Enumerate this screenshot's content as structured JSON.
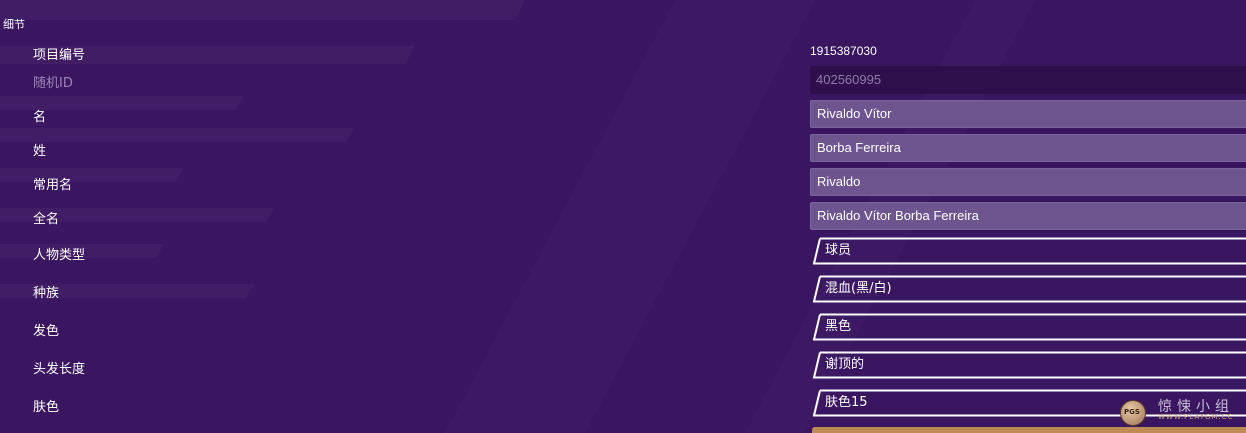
{
  "section": {
    "title": "细节"
  },
  "rows": {
    "project_id": {
      "label": "项目编号",
      "value": "1915387030"
    },
    "random_id": {
      "label": "随机ID",
      "value": "402560995"
    },
    "first_name": {
      "label": "名",
      "value": "Rivaldo Vítor"
    },
    "last_name": {
      "label": "姓",
      "value": "Borba Ferreira"
    },
    "common_name": {
      "label": "常用名",
      "value": "Rivaldo"
    },
    "full_name": {
      "label": "全名",
      "value": "Rivaldo Vítor Borba Ferreira"
    },
    "person_type": {
      "label": "人物类型",
      "value": "球员"
    },
    "ethnicity": {
      "label": "种族",
      "value": "混血(黑/白)"
    },
    "hair_colour": {
      "label": "发色",
      "value": "黑色"
    },
    "hair_length": {
      "label": "头发长度",
      "value": "谢顶的"
    },
    "skin_tone": {
      "label": "肤色",
      "value": "肤色15"
    }
  },
  "watermark": {
    "logo_text": "PGS",
    "title": "惊悚小组",
    "subtitle": "WWW.PLAYGM.CC"
  },
  "colors": {
    "background": "#3a1560",
    "text_field": "#6e5590",
    "readonly_field": "#2e0f4c",
    "dropdown_border": "#ffffff",
    "accent_bar": "#c08a56"
  }
}
